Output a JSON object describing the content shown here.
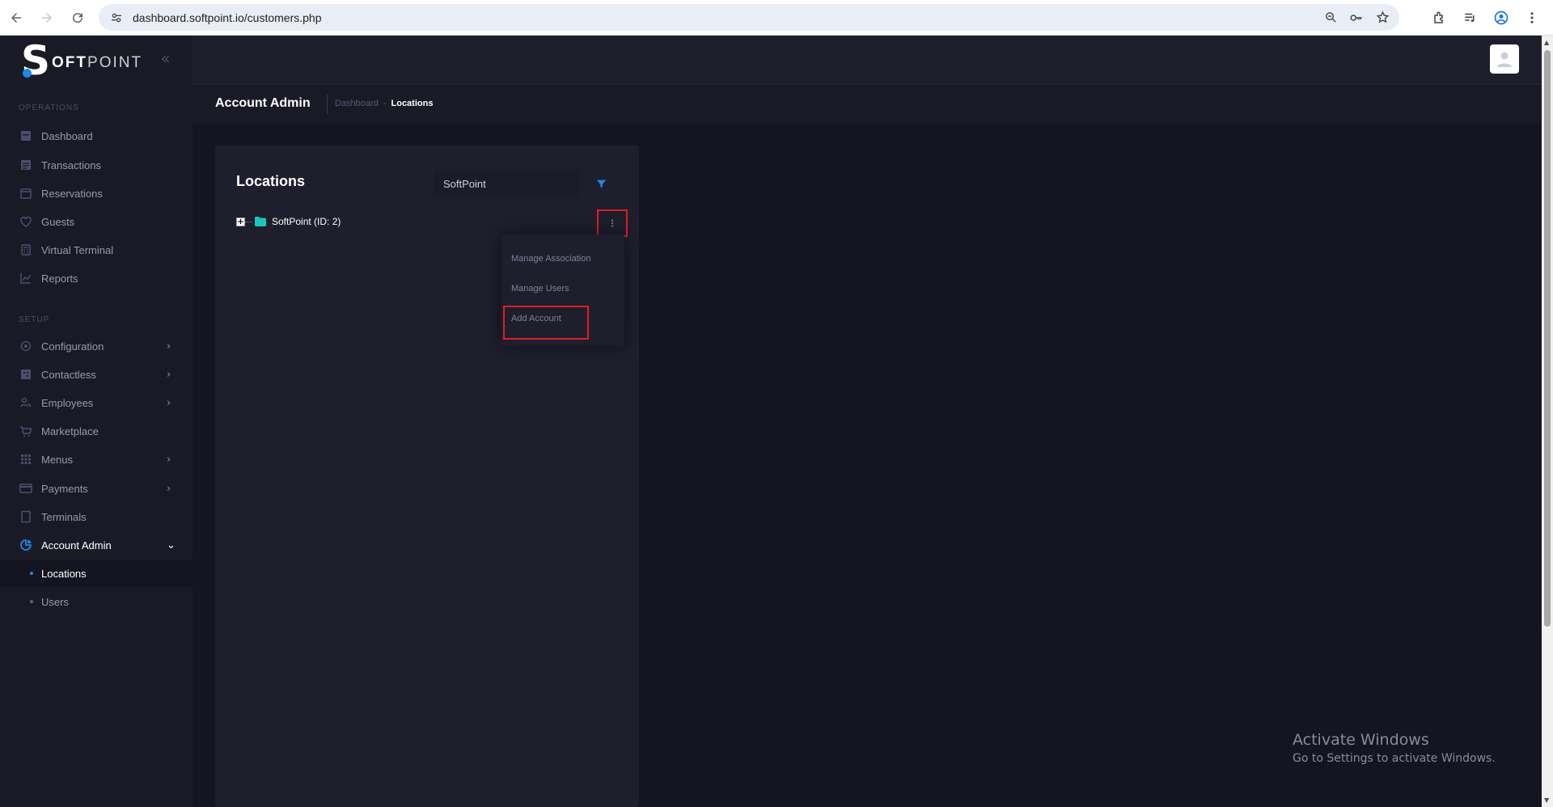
{
  "browser": {
    "url": "dashboard.softpoint.io/customers.php"
  },
  "brand": {
    "logo_letter": "S",
    "logo_light": "OFT",
    "logo_bold": "POINT"
  },
  "sidebar": {
    "operations_label": "OPERATIONS",
    "setup_label": "SETUP",
    "operations_items": [
      {
        "label": "Dashboard",
        "icon": "dashboard-icon"
      },
      {
        "label": "Transactions",
        "icon": "list-icon"
      },
      {
        "label": "Reservations",
        "icon": "calendar-icon"
      },
      {
        "label": "Guests",
        "icon": "heart-icon"
      },
      {
        "label": "Virtual Terminal",
        "icon": "calculator-icon"
      },
      {
        "label": "Reports",
        "icon": "chart-icon"
      }
    ],
    "setup_items": [
      {
        "label": "Configuration",
        "icon": "gear-icon"
      },
      {
        "label": "Contactless",
        "icon": "qr-icon"
      },
      {
        "label": "Employees",
        "icon": "employees-icon"
      },
      {
        "label": "Marketplace",
        "icon": "cart-icon"
      },
      {
        "label": "Menus",
        "icon": "grid-icon"
      },
      {
        "label": "Payments",
        "icon": "card-icon"
      },
      {
        "label": "Terminals",
        "icon": "tablet-icon"
      },
      {
        "label": "Account Admin",
        "icon": "pie-icon"
      }
    ],
    "sub_items": [
      {
        "label": "Locations"
      },
      {
        "label": "Users"
      }
    ]
  },
  "header": {
    "page_title": "Account Admin",
    "breadcrumb_parent": "Dashboard",
    "breadcrumb_sep": "-",
    "breadcrumb_current": "Locations"
  },
  "panel": {
    "title": "Locations",
    "search_value": "SoftPoint",
    "tree_node": "SoftPoint (ID: 2)",
    "menu": {
      "manage_association": "Manage Association",
      "manage_users": "Manage Users",
      "add_account": "Add Account"
    }
  },
  "watermark": {
    "title": "Activate Windows",
    "subtitle": "Go to Settings to activate Windows."
  },
  "colors": {
    "accent": "#1e88e5",
    "highlight": "#e01e1e",
    "folder": "#1bc5bd"
  }
}
